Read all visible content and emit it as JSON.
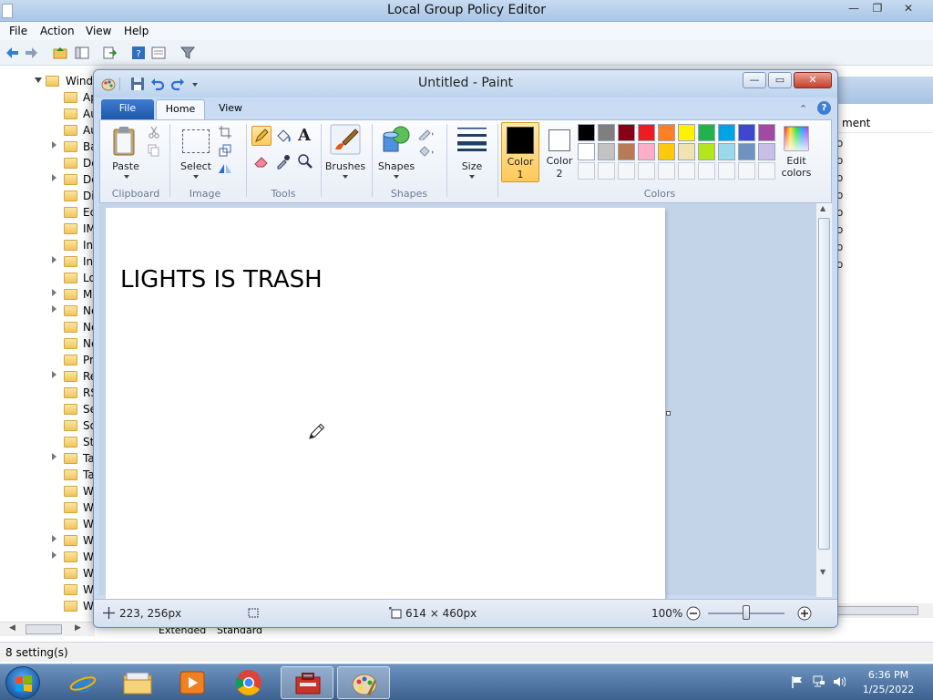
{
  "background_window": {
    "title": "Local Group Policy Editor",
    "menu": [
      "File",
      "Action",
      "View",
      "Help"
    ],
    "tree_root": "Windo",
    "tree_items": [
      "Ap",
      "Au",
      "Au",
      "Ba",
      "De",
      "De",
      "Di",
      "Ec",
      "IM",
      "In",
      "In",
      "Lo",
      "Mi",
      "Ne",
      "Ne",
      "Ne",
      "Pr",
      "Re",
      "RS",
      "Se",
      "So",
      "St",
      "Ta",
      "Ta",
      "Wi",
      "Wi",
      "Wi",
      "Wi",
      "Wi",
      "Wi",
      "Wi",
      "Wi"
    ],
    "right_column_header": "ment",
    "right_marks": [
      "o",
      "o",
      "o",
      "o",
      "o",
      "o",
      "o",
      "o"
    ],
    "view_tabs": [
      "Extended",
      "Standard"
    ],
    "status": "8 setting(s)"
  },
  "paint": {
    "title": "Untitled - Paint",
    "tabs": {
      "file": "File",
      "home": "Home",
      "view": "View"
    },
    "ribbon": {
      "clipboard": {
        "paste": "Paste",
        "label": "Clipboard"
      },
      "image": {
        "select": "Select",
        "label": "Image"
      },
      "tools": {
        "label": "Tools",
        "text_tool": "A"
      },
      "brushes": "Brushes",
      "shapes": {
        "shapes": "Shapes",
        "label": "Shapes"
      },
      "size": "Size",
      "color1": "Color\n1",
      "color1_line1": "Color",
      "color1_line2": "1",
      "color2_line1": "Color",
      "color2_line2": "2",
      "edit_colors_line1": "Edit",
      "edit_colors_line2": "colors",
      "colors_label": "Colors"
    },
    "palette_row1": [
      "#000000",
      "#7f7f7f",
      "#880015",
      "#ed1c24",
      "#ff7f27",
      "#fff200",
      "#22b14c",
      "#00a2e8",
      "#3f48cc",
      "#a349a4"
    ],
    "palette_row2": [
      "#ffffff",
      "#c3c3c3",
      "#b97a57",
      "#ffaec9",
      "#ffc90e",
      "#efe4b0",
      "#b5e61d",
      "#99d9ea",
      "#7092be",
      "#c8bfe7"
    ],
    "color1_value": "#000000",
    "color2_value": "#ffffff",
    "canvas_text": "LIGHTS IS TRASH",
    "status": {
      "cursor_pos": "223, 256px",
      "canvas_size": "614 × 460px",
      "zoom": "100%"
    }
  },
  "taskbar": {
    "time": "6:36 PM",
    "date": "1/25/2022"
  }
}
